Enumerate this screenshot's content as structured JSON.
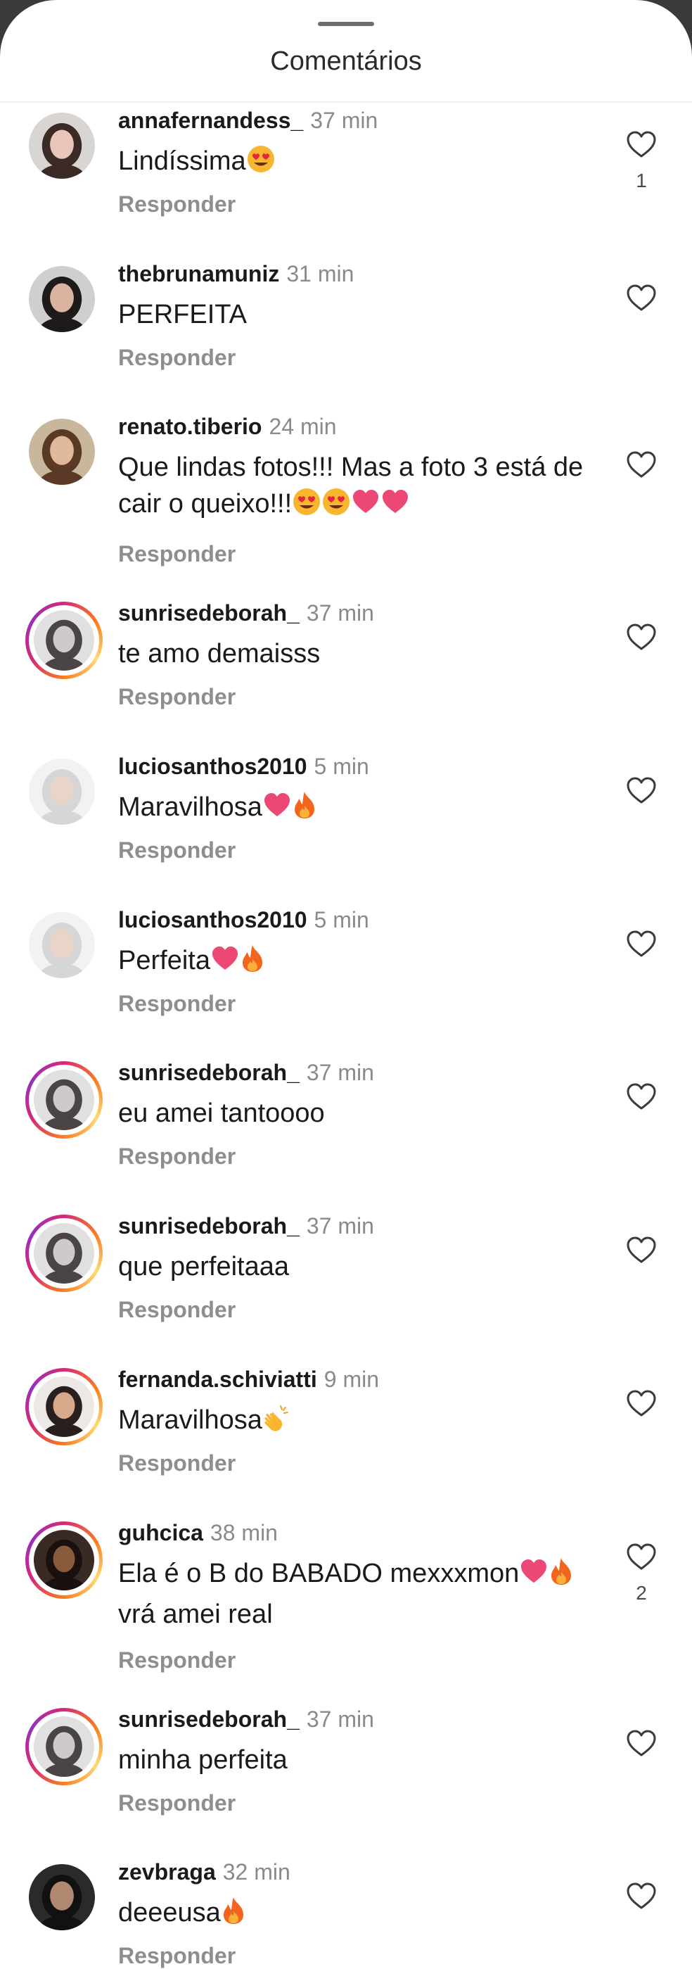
{
  "header": {
    "title": "Comentários"
  },
  "colors": {
    "ring": [
      "#d62976",
      "#fa7e1e",
      "#feda75",
      "#962fbf"
    ],
    "heart_red": "#ec4875",
    "fire": "#f3651c",
    "emoji_yellow": "#f8b52f"
  },
  "comments": [
    {
      "user": "annafernandess_",
      "time": "37 min",
      "text": "Lindíssima",
      "emoji": [
        "heart-eyes-emoji"
      ],
      "reply": "Responder",
      "likes": "1",
      "story_ring": false
    },
    {
      "user": "thebrunamuniz",
      "time": "31 min",
      "text": "PERFEITA",
      "emoji": [],
      "reply": "Responder",
      "likes": "",
      "story_ring": false
    },
    {
      "user": "renato.tiberio",
      "time": "24 min",
      "text": "Que lindas fotos!!! Mas a foto 3 está de cair o queixo!!!",
      "emoji": [
        "heart-eyes-emoji",
        "heart-eyes-emoji",
        "pink-heart-emoji",
        "pink-heart-emoji"
      ],
      "reply": "Responder",
      "likes": "",
      "story_ring": false
    },
    {
      "user": "sunrisedeborah_",
      "time": "37 min",
      "text": "te amo demaisss",
      "emoji": [],
      "reply": "Responder",
      "likes": "",
      "story_ring": true
    },
    {
      "user": "luciosanthos2010",
      "time": "5 min",
      "text": "Maravilhosa",
      "emoji": [
        "pink-heart-emoji",
        "fire-emoji"
      ],
      "reply": "Responder",
      "likes": "",
      "story_ring": false
    },
    {
      "user": "luciosanthos2010",
      "time": "5 min",
      "text": "Perfeita",
      "emoji": [
        "pink-heart-emoji",
        "fire-emoji"
      ],
      "reply": "Responder",
      "likes": "",
      "story_ring": false
    },
    {
      "user": "sunrisedeborah_",
      "time": "37 min",
      "text": "eu amei tantoooo",
      "emoji": [],
      "reply": "Responder",
      "likes": "",
      "story_ring": true
    },
    {
      "user": "sunrisedeborah_",
      "time": "37 min",
      "text": "que perfeitaaa",
      "emoji": [],
      "reply": "Responder",
      "likes": "",
      "story_ring": true
    },
    {
      "user": "fernanda.schiviatti",
      "time": "9 min",
      "text": "Maravilhosa",
      "emoji": [
        "clapping-hands-emoji"
      ],
      "reply": "Responder",
      "likes": "",
      "story_ring": true
    },
    {
      "user": "guhcica",
      "time": "38 min",
      "text": "Ela é o B do BABADO mexxxmon",
      "emoji": [
        "pink-heart-emoji",
        "fire-emoji"
      ],
      "text_after": "vrá amei real",
      "reply": "Responder",
      "likes": "2",
      "story_ring": true
    },
    {
      "user": "sunrisedeborah_",
      "time": "37 min",
      "text": "minha perfeita",
      "emoji": [],
      "reply": "Responder",
      "likes": "",
      "story_ring": true
    },
    {
      "user": "zevbraga",
      "time": "32 min",
      "text": "deeeusa",
      "emoji": [
        "fire-emoji"
      ],
      "reply": "Responder",
      "likes": "",
      "story_ring": false
    }
  ]
}
